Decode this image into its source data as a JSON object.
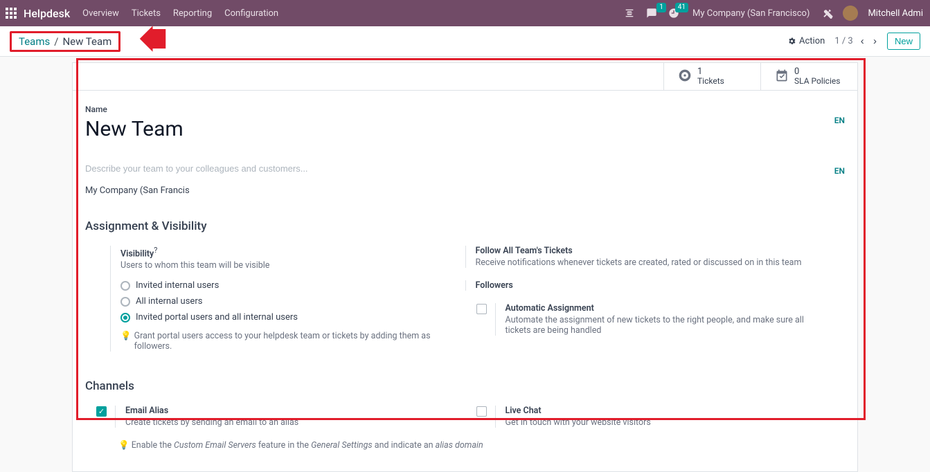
{
  "topnav": {
    "brand": "Helpdesk",
    "links": [
      "Overview",
      "Tickets",
      "Reporting",
      "Configuration"
    ],
    "msg_badge": "1",
    "clock_badge": "41",
    "company": "My Company (San Francisco)",
    "user": "Mitchell Admi"
  },
  "crumb": {
    "root": "Teams",
    "current": "New Team",
    "action": "Action",
    "pager": "1 / 3",
    "new_btn": "New"
  },
  "stats": {
    "tickets_num": "1",
    "tickets_label": "Tickets",
    "sla_num": "0",
    "sla_label": "SLA Policies"
  },
  "form": {
    "name_label": "Name",
    "name_value": "New Team",
    "lang1": "EN",
    "desc_placeholder": "Describe your team to your colleagues and customers...",
    "lang2": "EN",
    "company": "My Company (San Francis"
  },
  "sections": {
    "assign": "Assignment & Visibility",
    "channels": "Channels"
  },
  "visibility": {
    "label": "Visibility",
    "q": "?",
    "help": "Users to whom this team will be visible",
    "opt1": "Invited internal users",
    "opt2": "All internal users",
    "opt3": "Invited portal users and all internal users",
    "tip": "Grant portal users access to your helpdesk team or tickets by adding them as followers."
  },
  "right": {
    "follow_title": "Follow All Team's Tickets",
    "follow_help": "Receive notifications whenever tickets are created, rated or discussed on in this team",
    "followers_title": "Followers",
    "auto_title": "Automatic Assignment",
    "auto_help": "Automate the assignment of new tickets to the right people, and make sure all tickets are being handled"
  },
  "channels_block": {
    "email_title": "Email Alias",
    "email_help": "Create tickets by sending an email to an alias",
    "email_tip_pre": "Enable the ",
    "email_tip_i1": "Custom Email Servers",
    "email_tip_mid": " feature in the ",
    "email_tip_i2": "General Settings",
    "email_tip_post": " and indicate an ",
    "email_tip_i3": "alias domain",
    "live_title": "Live Chat",
    "live_help": "Get in touch with your website visitors"
  }
}
